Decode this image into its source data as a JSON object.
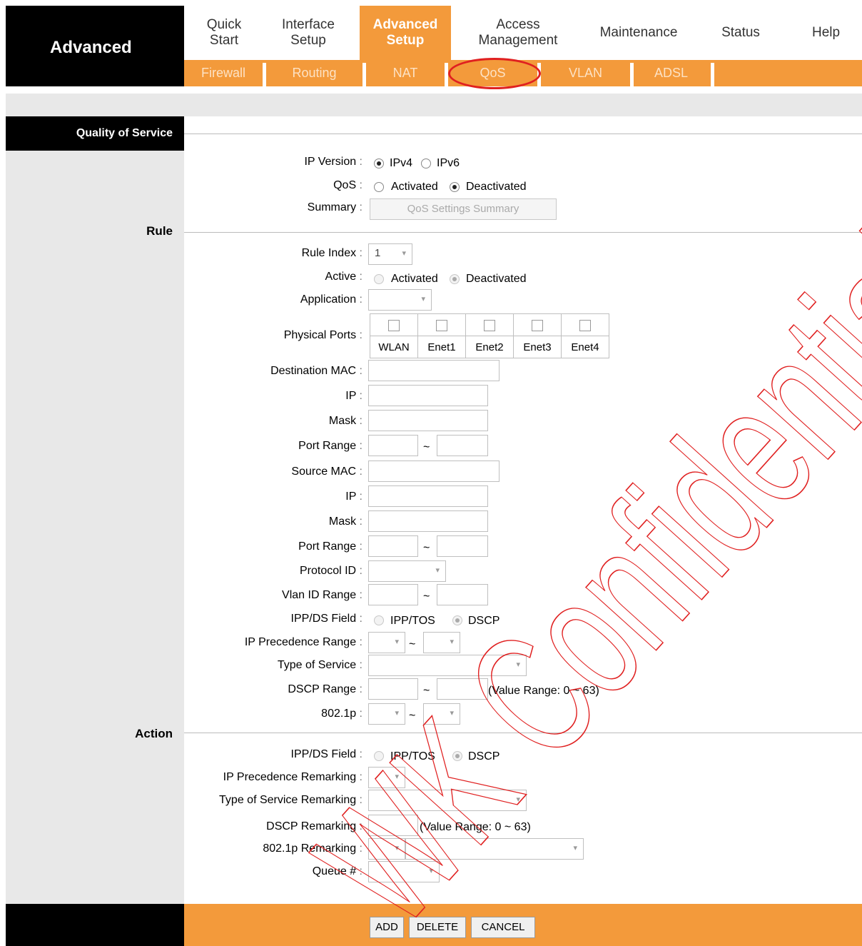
{
  "brand": {
    "title": "Advanced"
  },
  "nav": {
    "tabs": [
      {
        "line1": "Quick",
        "line2": "Start"
      },
      {
        "line1": "Interface",
        "line2": "Setup"
      },
      {
        "line1": "Advanced",
        "line2": "Setup"
      },
      {
        "line1": "Access",
        "line2": "Management"
      },
      {
        "line1": "Maintenance",
        "line2": ""
      },
      {
        "line1": "Status",
        "line2": ""
      },
      {
        "line1": "Help",
        "line2": ""
      }
    ],
    "active_tab": "Advanced Setup",
    "subtabs": [
      "Firewall",
      "Routing",
      "NAT",
      "QoS",
      "VLAN",
      "ADSL"
    ],
    "active_subtab": "QoS"
  },
  "sections": {
    "qos": "Quality of Service",
    "rule": "Rule",
    "action": "Action"
  },
  "general": {
    "ip_version_label": "IP Version",
    "ipv4": "IPv4",
    "ipv6": "IPv6",
    "qos_label": "QoS",
    "activated": "Activated",
    "deactivated": "Deactivated",
    "summary_label": "Summary",
    "summary_button": "QoS Settings Summary"
  },
  "rule": {
    "rule_index_label": "Rule Index",
    "rule_index_value": "1",
    "active_label": "Active",
    "activated": "Activated",
    "deactivated": "Deactivated",
    "application_label": "Application",
    "physical_ports_label": "Physical Ports",
    "ports": [
      "WLAN",
      "Enet1",
      "Enet2",
      "Enet3",
      "Enet4"
    ],
    "dest_mac_label": "Destination MAC",
    "ip_label": "IP",
    "mask_label": "Mask",
    "port_range_label": "Port Range",
    "source_mac_label": "Source MAC",
    "protocol_id_label": "Protocol ID",
    "vlan_id_range_label": "Vlan ID Range",
    "ippds_label": "IPP/DS Field",
    "ipp_tos": "IPP/TOS",
    "dscp": "DSCP",
    "ip_prec_range_label": "IP Precedence Range",
    "tos_label": "Type of Service",
    "dscp_range_label": "DSCP Range",
    "dscp_range_hint": "(Value Range: 0 ~ 63)",
    "dot1p_label": "802.1p",
    "tilde": "~"
  },
  "action": {
    "ippds_label": "IPP/DS Field",
    "ipp_tos": "IPP/TOS",
    "dscp": "DSCP",
    "ip_prec_remark_label": "IP Precedence Remarking",
    "tos_remark_label": "Type of Service Remarking",
    "dscp_remark_label": "DSCP Remarking",
    "dscp_remark_hint": "(Value Range: 0 ~ 63)",
    "dot1p_remark_label": "802.1p Remarking",
    "queue_label": "Queue #"
  },
  "footer": {
    "add": "ADD",
    "delete": "DELETE",
    "cancel": "CANCEL"
  },
  "watermark": {
    "text": "WK Confidential"
  },
  "colors": {
    "accent": "#f39a3b",
    "highlight_circle": "#e02020"
  }
}
